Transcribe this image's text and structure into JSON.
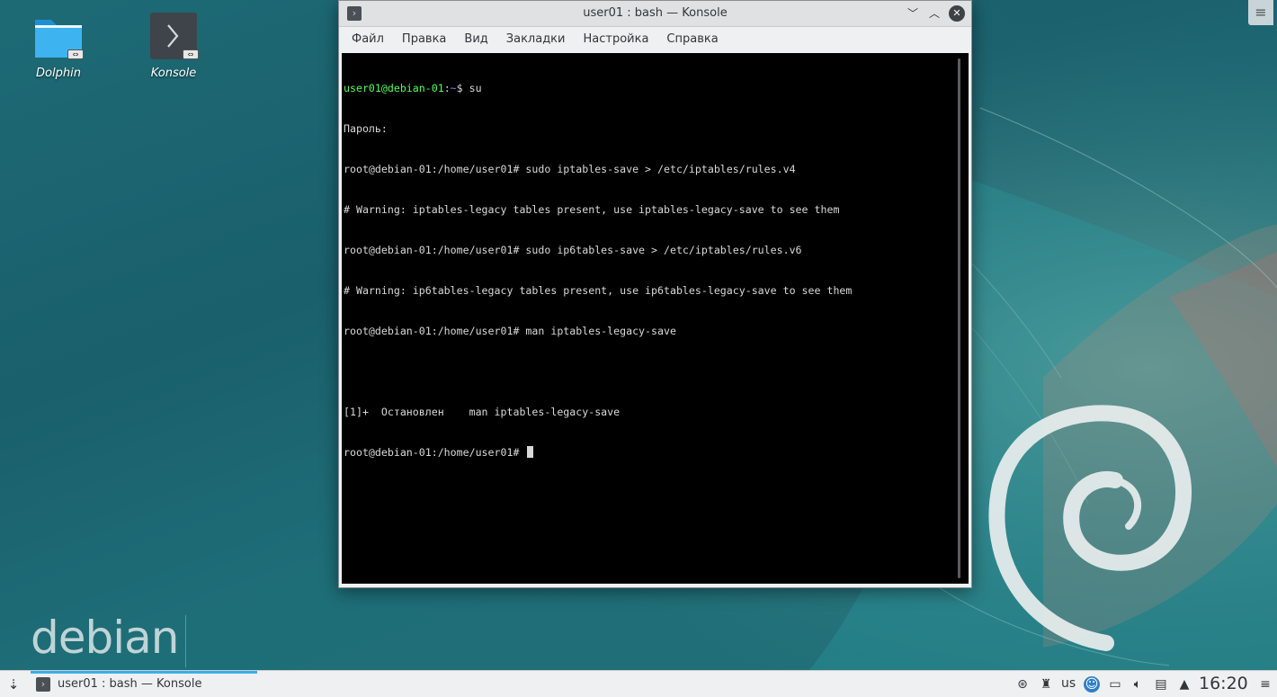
{
  "desktop": {
    "brand": "debian",
    "icons": [
      {
        "label": "Dolphin",
        "icon": "folder-icon"
      },
      {
        "label": "Konsole",
        "icon": "terminal-icon"
      }
    ]
  },
  "window": {
    "title": "user01 : bash — Konsole",
    "menu": [
      "Файл",
      "Правка",
      "Вид",
      "Закладки",
      "Настройка",
      "Справка"
    ]
  },
  "terminal": {
    "prompt_user": "user01@debian-01",
    "prompt_path": "~",
    "lines": {
      "l1_cmd": "su",
      "l2": "Пароль:",
      "l3": "root@debian-01:/home/user01# sudo iptables-save > /etc/iptables/rules.v4",
      "l4": "# Warning: iptables-legacy tables present, use iptables-legacy-save to see them",
      "l5": "root@debian-01:/home/user01# sudo ip6tables-save > /etc/iptables/rules.v6",
      "l6": "# Warning: ip6tables-legacy tables present, use ip6tables-legacy-save to see them",
      "l7": "root@debian-01:/home/user01# man iptables-legacy-save",
      "l8": "",
      "l9": "[1]+  Остановлен    man iptables-legacy-save",
      "l10": "root@debian-01:/home/user01# "
    }
  },
  "taskbar": {
    "task_label": "user01 : bash — Konsole",
    "keyboard_layout": "us",
    "clock": "16:20"
  },
  "colors": {
    "accent": "#3daee9",
    "terminal_bg": "#000000",
    "prompt_green": "#54ff54",
    "prompt_blue": "#5c8cff"
  }
}
